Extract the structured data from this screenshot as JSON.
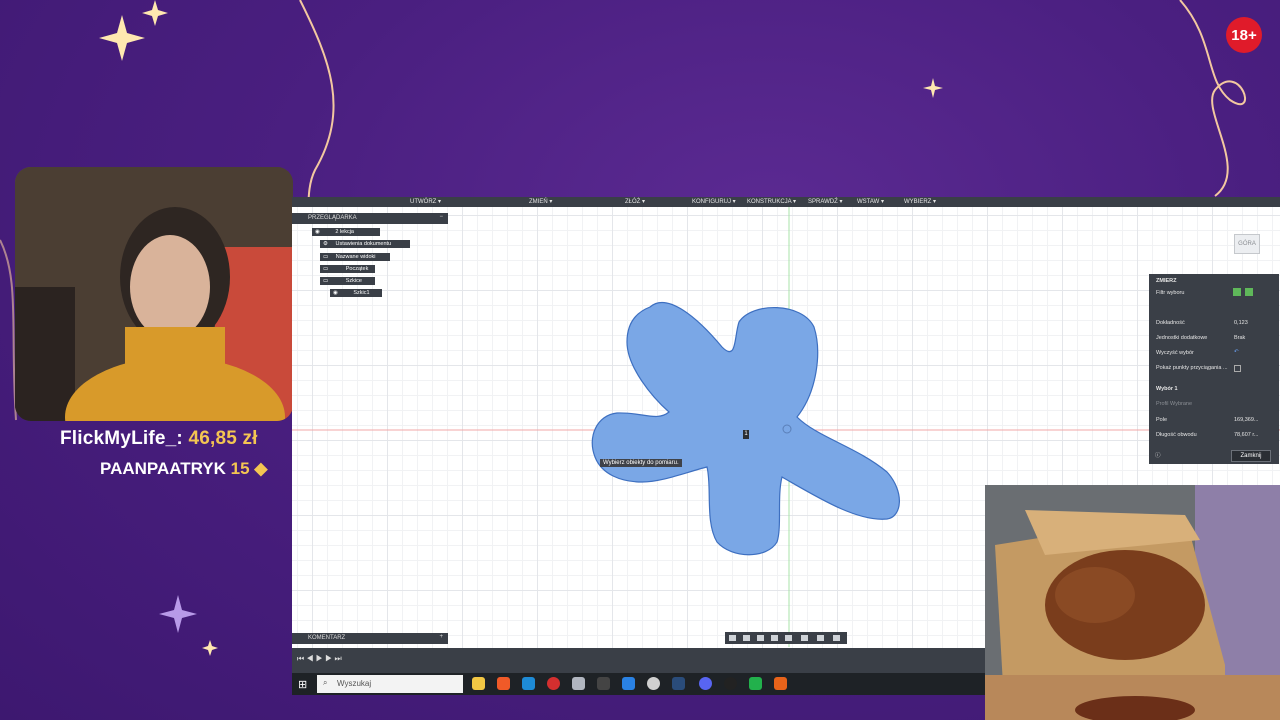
{
  "overlay": {
    "donation_name": "FlickMyLife_:",
    "donation_amount": "46,85 zł",
    "sub_name": "PAANPAATRYK",
    "sub_count": "15",
    "age_badge": "18+"
  },
  "cad": {
    "menu": [
      "UTWÓRZ ▾",
      "ZMIEŃ ▾",
      "ZŁÓŻ ▾",
      "KONFIGURUJ ▾",
      "KONSTRUKCJA ▾",
      "SPRAWDŹ ▾",
      "WSTAW ▾",
      "WYBIERZ ▾"
    ],
    "browser_title": "PRZEGLĄDARKA",
    "tree": {
      "root": "2 lekcja",
      "items": [
        "Ustawienia dokumentu",
        "Nazwane widoki",
        "Początek",
        "Szkice"
      ],
      "sketch": "Szkic1"
    },
    "comment_label": "KOMENTARZ",
    "tooltip": "Wybierz obiekty do pomiaru.",
    "sketch_marker": "1",
    "viewcube": "GÓRA",
    "measure": {
      "title": "ZMIERZ",
      "filter_label": "Filtr wyboru",
      "precision_label": "Dokładność",
      "precision_value": "0,123",
      "units_label": "Jednostki dodatkowe",
      "units_value": "Brak",
      "clear_label": "Wyczyść wybór",
      "snap_label": "Pokaż punkty przyciągania ...",
      "selection_header": "Wybór 1",
      "selection_type": "Profil Wybrane",
      "area_label": "Pole",
      "area_value": "169,369...",
      "perimeter_label": "Długość obwodu",
      "perimeter_value": "78,607 r...",
      "close_label": "Zamknij"
    },
    "shape_color": "#7aa7e6"
  },
  "taskbar": {
    "search_placeholder": "Wyszukaj"
  },
  "colors": {
    "background": "#4a1f80",
    "accent_gold": "#f4c552",
    "badge_red": "#e01b2a"
  }
}
